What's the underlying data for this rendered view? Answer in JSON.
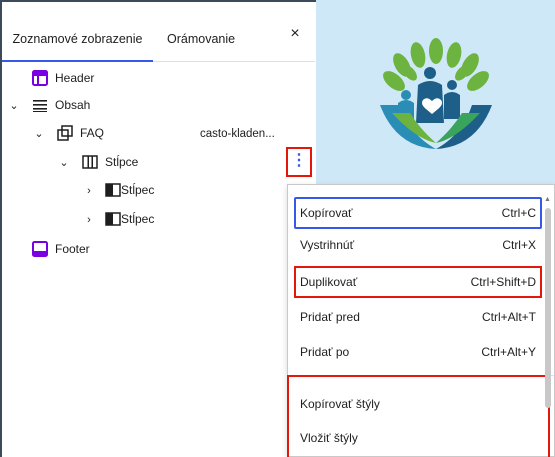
{
  "tabs": {
    "list_view": "Zoznamové zobrazenie",
    "outline": "Orámovanie",
    "close": "×"
  },
  "tree": {
    "header": "Header",
    "content": "Obsah",
    "faq": "FAQ",
    "faq_anchor": "casto-kladen...",
    "columns": "Stĺpce",
    "column_1": "Stĺpec",
    "column_2": "Stĺpec",
    "footer": "Footer"
  },
  "more_options": "⋮",
  "menu": {
    "items": [
      {
        "label": "Kopírovať",
        "shortcut": "Ctrl+C"
      },
      {
        "label": "Vystrihnúť",
        "shortcut": "Ctrl+X"
      },
      {
        "label": "Duplikovať",
        "shortcut": "Ctrl+Shift+D"
      },
      {
        "label": "Pridať pred",
        "shortcut": "Ctrl+Alt+T"
      },
      {
        "label": "Pridať po",
        "shortcut": "Ctrl+Alt+Y"
      },
      {
        "label": "Kopírovať štýly",
        "shortcut": ""
      },
      {
        "label": "Vložiť štýly",
        "shortcut": ""
      }
    ]
  },
  "colors": {
    "accent": "#3858e9",
    "highlight": "#e3170a",
    "template_part": "#7a00df",
    "preview_bg": "#cfe8f8"
  }
}
